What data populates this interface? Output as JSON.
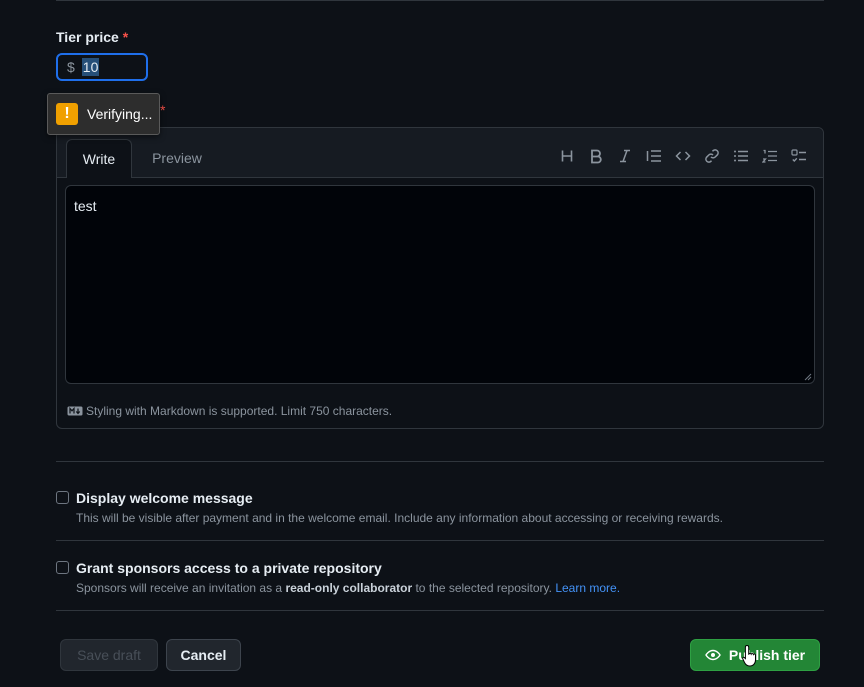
{
  "price": {
    "label": "Tier price",
    "required_mark": "*",
    "currency": "$",
    "value": "10"
  },
  "tooltip": {
    "icon": "warning-icon",
    "text": "Verifying..."
  },
  "description": {
    "required_mark": "*"
  },
  "editor": {
    "tabs": [
      "Write",
      "Preview"
    ],
    "active_tab": "Write",
    "toolbar": [
      "heading-icon",
      "bold-icon",
      "italic-icon",
      "quote-icon",
      "code-icon",
      "link-icon",
      "bulleted-list-icon",
      "numbered-list-icon",
      "task-list-icon"
    ],
    "content": "test",
    "markdown_note": "Styling with Markdown is supported. Limit 750 characters."
  },
  "options": [
    {
      "title": "Display welcome message",
      "description": "This will be visible after payment and in the welcome email. Include any information about accessing or receiving rewards.",
      "checked": false
    },
    {
      "title": "Grant sponsors access to a private repository",
      "description_prefix": "Sponsors will receive an invitation as a ",
      "description_bold": "read-only collaborator",
      "description_suffix": " to the selected repository. ",
      "link": "Learn more.",
      "checked": false
    }
  ],
  "buttons": {
    "save_draft": "Save draft",
    "cancel": "Cancel",
    "publish": "Publish tier"
  },
  "colors": {
    "background": "#0d1117",
    "accent": "#1f6feb",
    "primary_button": "#238636",
    "warning": "#f0a000",
    "link": "#4493f8"
  }
}
